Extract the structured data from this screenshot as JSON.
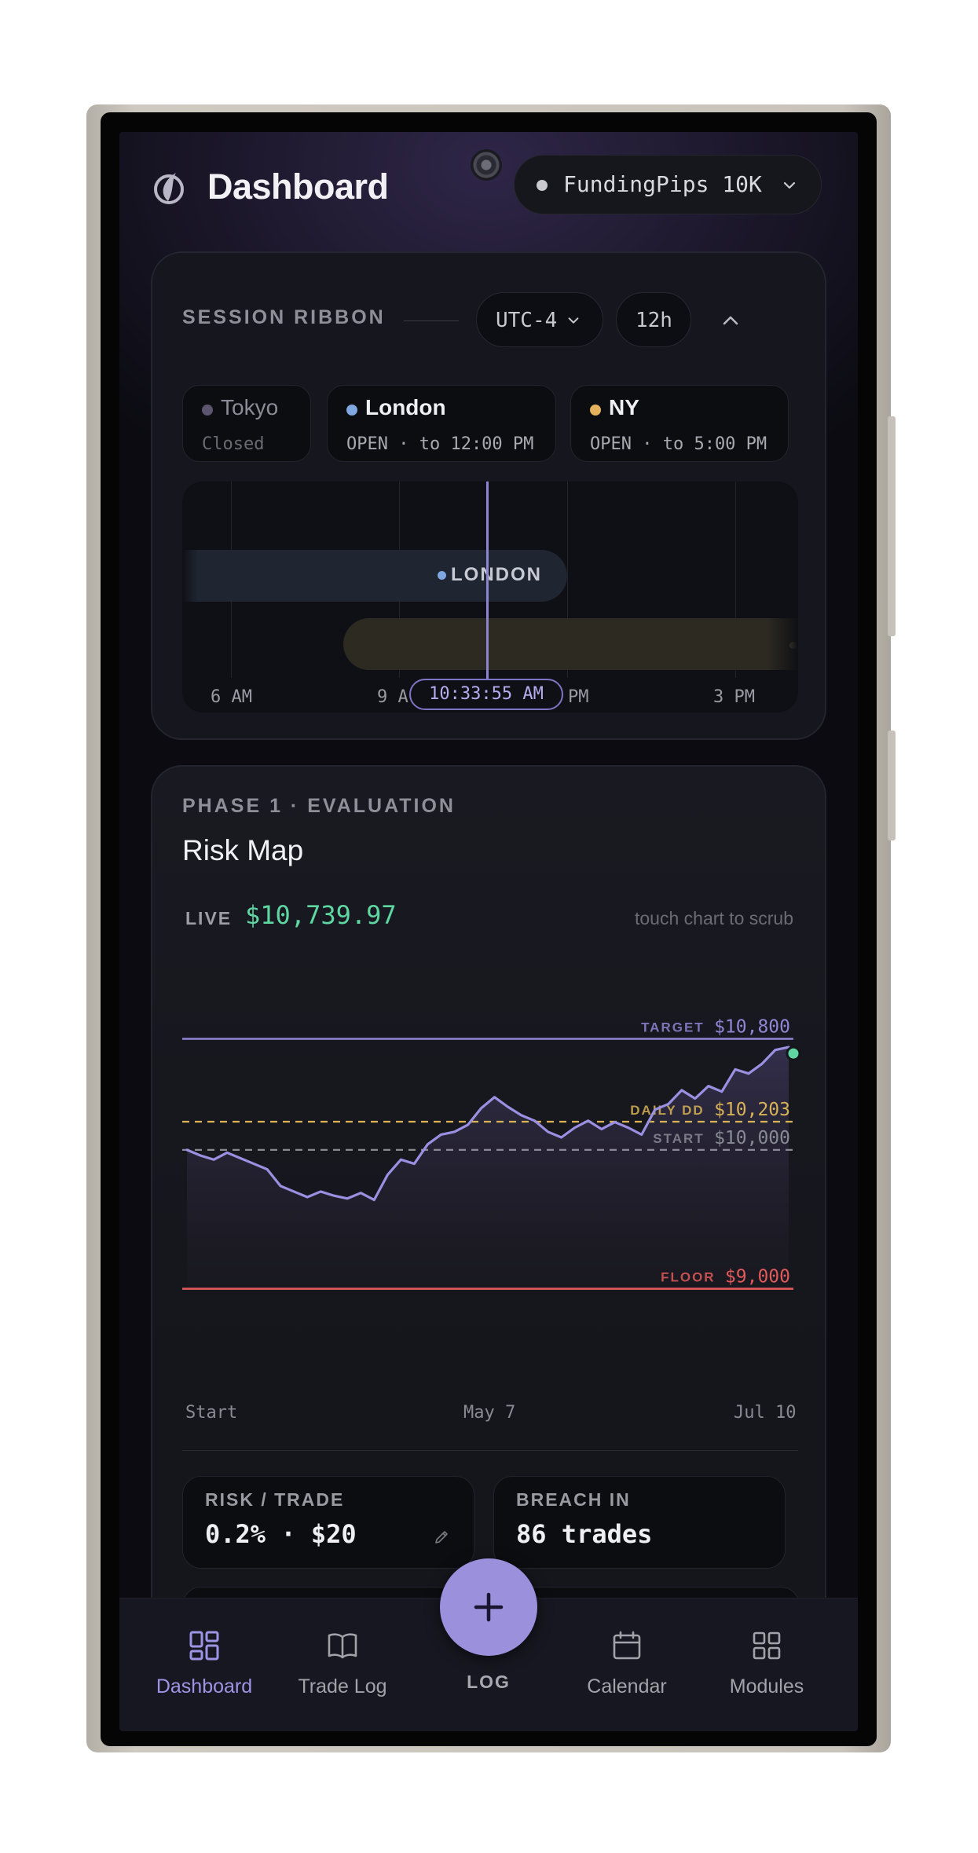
{
  "header": {
    "title": "Dashboard",
    "account": "FundingPips 10K"
  },
  "session_ribbon": {
    "label": "SESSION RIBBON",
    "timezone": "UTC-4",
    "range": "12h",
    "sessions": [
      {
        "name": "Tokyo",
        "status": "Closed",
        "color": "#5c5570"
      },
      {
        "name": "London",
        "status": "OPEN · to 12:00 PM",
        "color": "#7fa7e0"
      },
      {
        "name": "NY",
        "status": "OPEN · to 5:00 PM",
        "color": "#e6b15c"
      }
    ],
    "band_label": "LONDON",
    "ticks": [
      "6 AM",
      "9 A",
      "PM",
      "3 PM"
    ],
    "current_time": "10:33:55 AM"
  },
  "risk_map": {
    "phase": "PHASE 1 · EVALUATION",
    "title": "Risk Map",
    "live_label": "LIVE",
    "live_value": "$10,739.97",
    "hint": "touch chart to scrub",
    "x_labels": [
      "Start",
      "May 7",
      "Jul 10"
    ],
    "stats": [
      {
        "label": "RISK / TRADE",
        "value": "0.2% · $20"
      },
      {
        "label": "BREACH IN",
        "value": "86 trades"
      }
    ]
  },
  "chart_data": {
    "type": "line",
    "ylim": [
      8800,
      10950
    ],
    "levels": [
      {
        "label": "TARGET",
        "value": 10800,
        "value_text": "$10,800",
        "color": "#8f86d6"
      },
      {
        "label": "DAILY DD",
        "value": 10203,
        "value_text": "$10,203",
        "color": "#d8b356"
      },
      {
        "label": "START",
        "value": 10000,
        "value_text": "$10,000",
        "color": "#8a8a94"
      },
      {
        "label": "FLOOR",
        "value": 9000,
        "value_text": "$9,000",
        "color": "#e05a5a"
      }
    ],
    "series": [
      {
        "values": [
          10000,
          9960,
          9930,
          9980,
          9940,
          9900,
          9860,
          9740,
          9700,
          9660,
          9700,
          9670,
          9650,
          9690,
          9640,
          9820,
          9930,
          9900,
          10040,
          10110,
          10130,
          10180,
          10300,
          10380,
          10310,
          10250,
          10210,
          10130,
          10090,
          10160,
          10210,
          10150,
          10200,
          10160,
          10110,
          10290,
          10330,
          10430,
          10370,
          10460,
          10420,
          10580,
          10550,
          10620,
          10720,
          10740
        ]
      }
    ],
    "accent_line": "#9a8fe0"
  },
  "nav": {
    "items": [
      {
        "label": "Dashboard",
        "icon": "dashboard-grid-icon"
      },
      {
        "label": "Trade Log",
        "icon": "book-icon"
      },
      {
        "label": "Calendar",
        "icon": "calendar-icon"
      },
      {
        "label": "Modules",
        "icon": "modules-grid-icon"
      }
    ],
    "fab_label": "LOG"
  }
}
